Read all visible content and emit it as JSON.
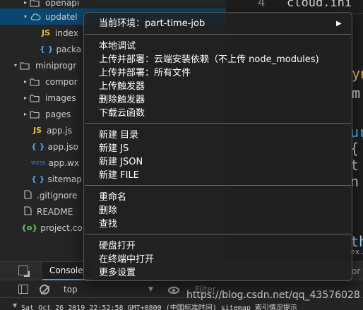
{
  "tree": [
    {
      "label": "openapi",
      "kind": "folder",
      "twisty": "▸",
      "indent": 1,
      "clip": true
    },
    {
      "label": "updatel",
      "kind": "cloud",
      "twisty": "▾",
      "indent": 1,
      "selected": true
    },
    {
      "label": "index",
      "kind": "js",
      "indent": 3
    },
    {
      "label": "packa",
      "kind": "json",
      "indent": 3
    },
    {
      "label": "miniprogr",
      "kind": "folder",
      "twisty": "▾",
      "indent": 0
    },
    {
      "label": "compor",
      "kind": "folder",
      "twisty": "▸",
      "indent": 1
    },
    {
      "label": "images",
      "kind": "folder",
      "twisty": "▸",
      "indent": 1
    },
    {
      "label": "pages",
      "kind": "folder",
      "twisty": "▸",
      "indent": 1
    },
    {
      "label": "app.js",
      "kind": "js",
      "indent": 2
    },
    {
      "label": "app.jso",
      "kind": "json",
      "indent": 2
    },
    {
      "label": "app.wx",
      "kind": "wxss",
      "indent": 2
    },
    {
      "label": "sitemap",
      "kind": "json",
      "indent": 2
    },
    {
      "label": ".gitignore",
      "kind": "file",
      "indent": 1
    },
    {
      "label": "README",
      "kind": "file",
      "indent": 1
    },
    {
      "label": "project.co",
      "kind": "gear",
      "indent": 1
    }
  ],
  "icons": {
    "js": "JS",
    "json": "{ }",
    "wxss": "WXSS",
    "gear": "{o}"
  },
  "editor": {
    "line_number": "4",
    "line_text": "cloud.ini",
    "fragments": [
      {
        "text": "ync",
        "color": "#e8c070"
      },
      {
        "text": "m",
        "color": "#d4d4d4"
      },
      {
        "text": "ur",
        "color": "#4fc1ff"
      },
      {
        "text": "{",
        "color": "#d4d4d4"
      },
      {
        "text": "t",
        "color": "#d4d4d4"
      },
      {
        "text": "n",
        "color": "#d4d4d4"
      },
      {
        "text": "th",
        "color": "#9cdcfe"
      },
      {
        "text": "ex.js",
        "color": "#bbbbbb"
      }
    ]
  },
  "menu": {
    "env_label": "当前环境：part-time-job",
    "groups": [
      [
        "本地调试",
        "上传并部署：云端安装依赖（不上传 node_modules)",
        "上传并部署：所有文件",
        "上传触发器",
        "删除触发器",
        "下载云函数"
      ],
      [
        "新建 目录",
        "新建 JS",
        "新建 JSON",
        "新建 FILE"
      ],
      [
        "重命名",
        "删除",
        "查找"
      ],
      [
        "硬盘打开",
        "在终端中打开",
        "更多设置"
      ]
    ]
  },
  "devtools": {
    "tab": "Console",
    "right_tab": "or",
    "context": "top",
    "filter_placeholder": "Filter",
    "right_label": "De",
    "log": "Sat Oct 26 2019 22:52:58 GMT+0800 (中国标准时间) sitemap 索引情况提示"
  },
  "watermark": "https://blog.csdn.net/qq_43576028",
  "colors": {
    "selection": "#094771",
    "menu_bg": "#2a2a2a",
    "accent": "#4d90fe"
  }
}
